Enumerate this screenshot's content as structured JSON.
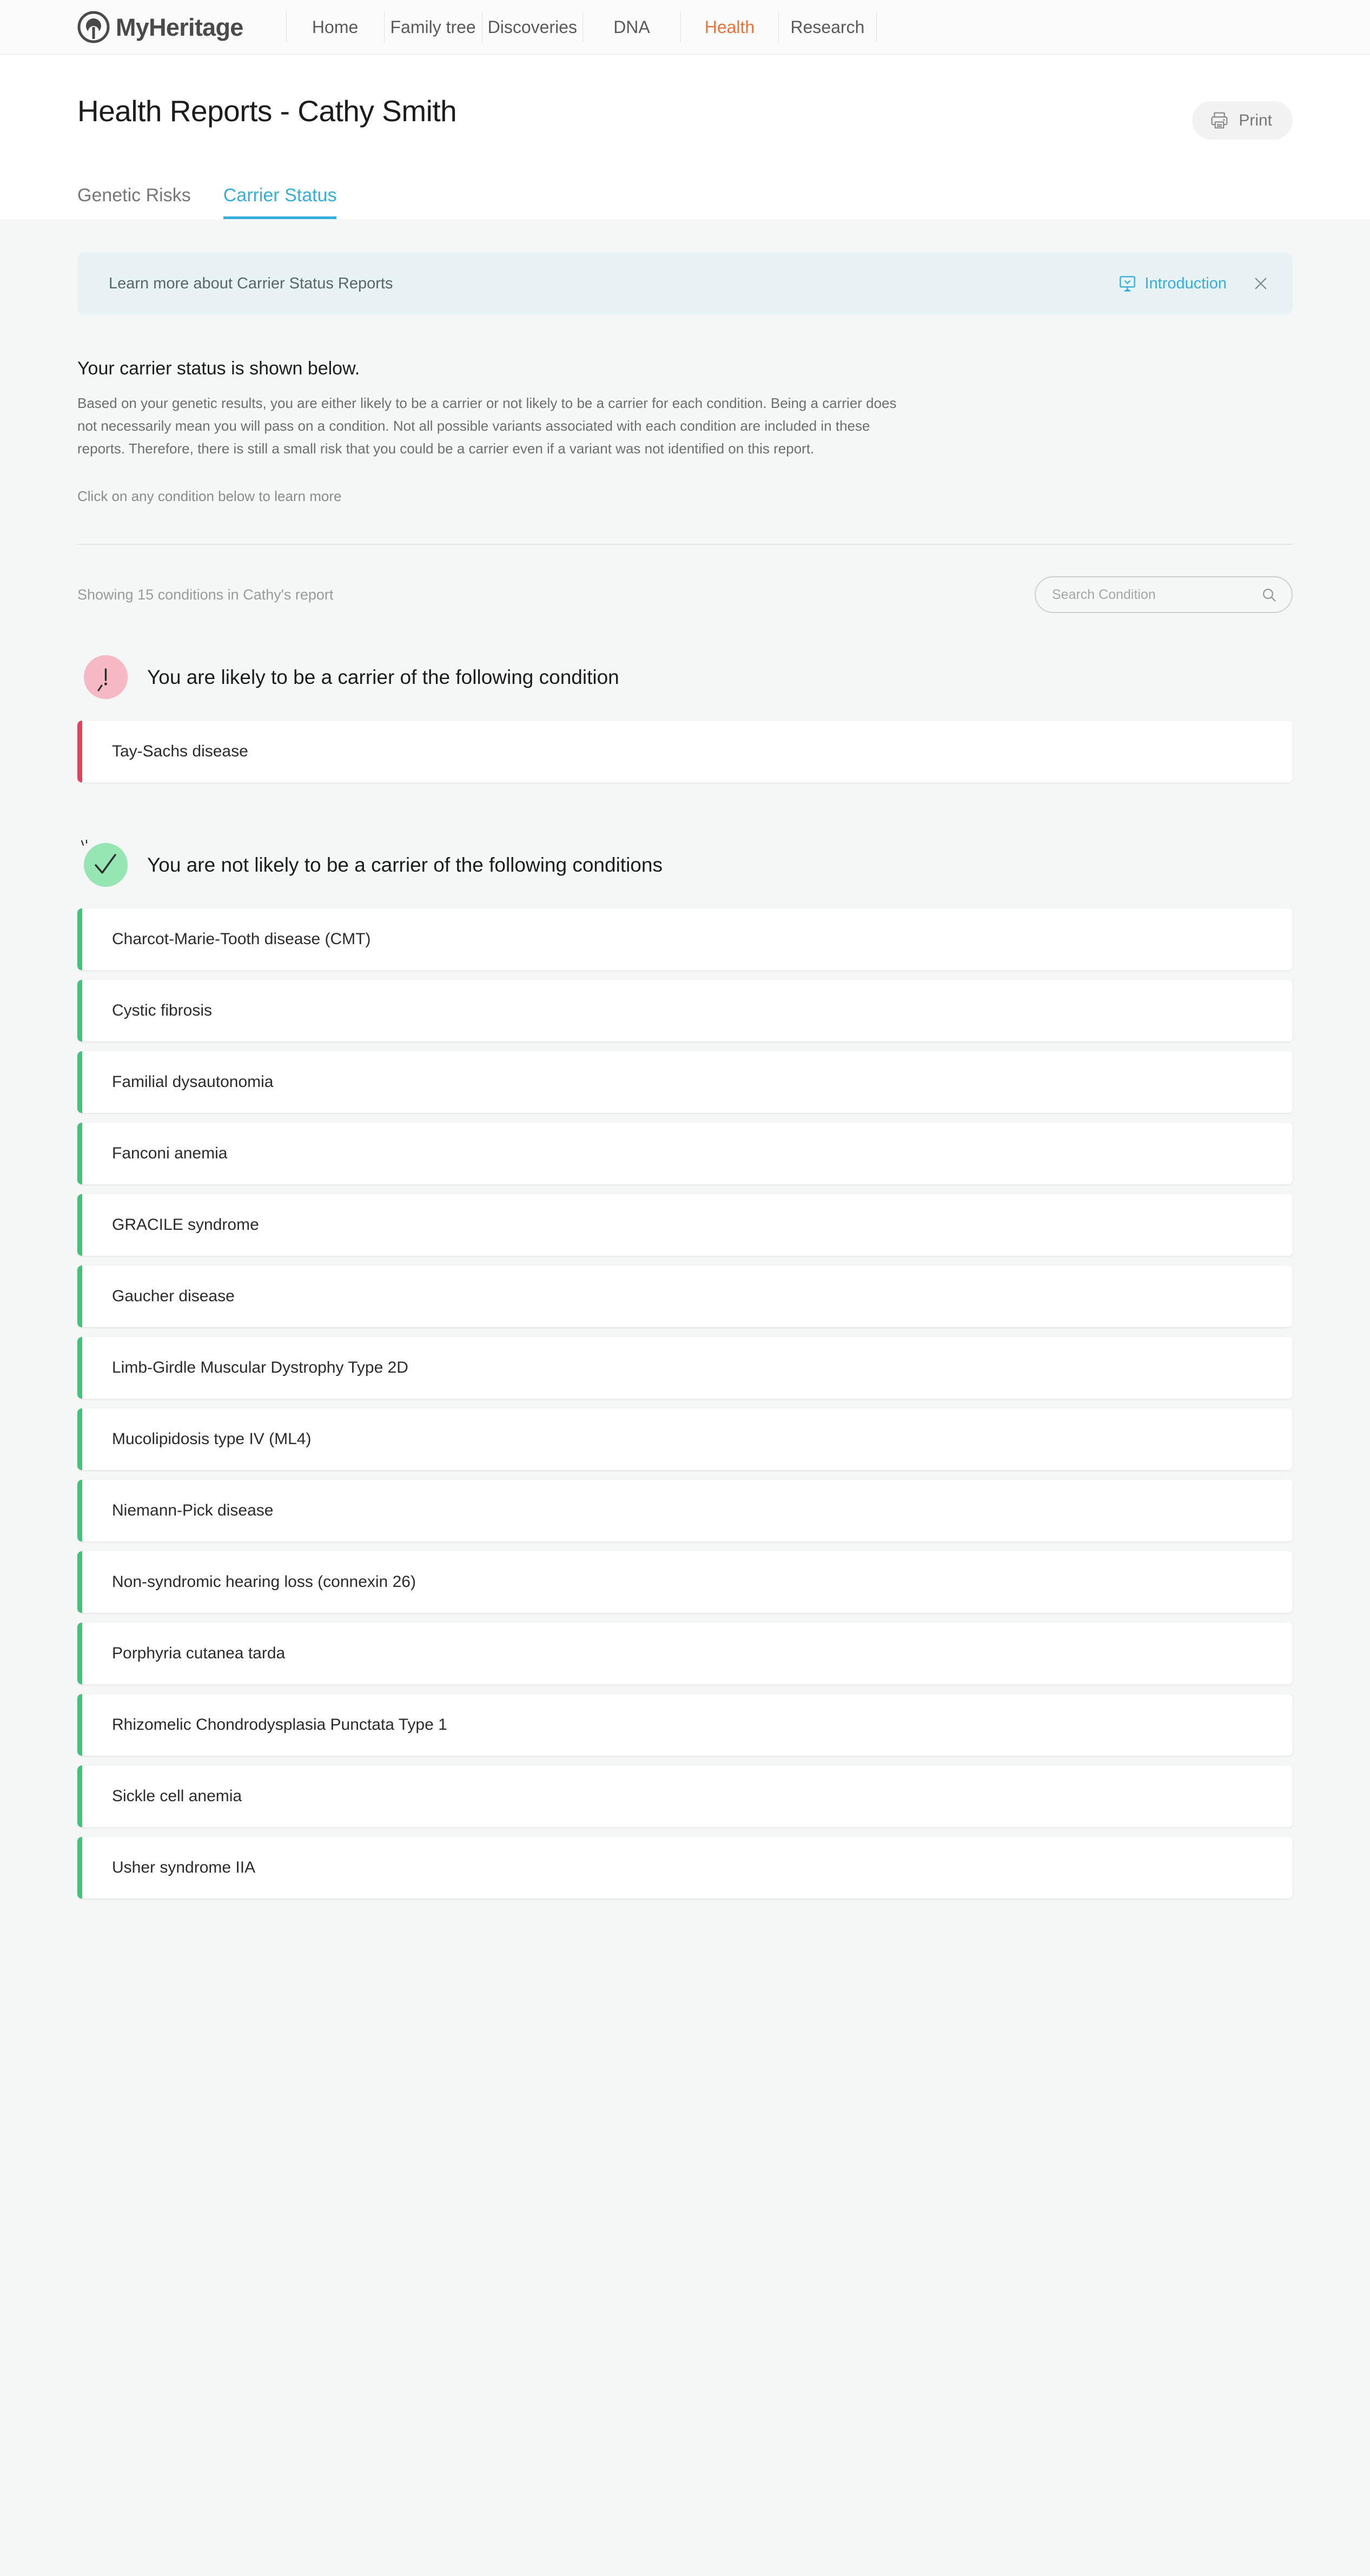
{
  "brand": {
    "name": "MyHeritage",
    "logo_icon": "myheritage-tree-logo"
  },
  "nav": {
    "items": [
      {
        "label": "Home",
        "active": false
      },
      {
        "label": "Family tree",
        "active": false
      },
      {
        "label": "Discoveries",
        "active": false
      },
      {
        "label": "DNA",
        "active": false
      },
      {
        "label": "Health",
        "active": true
      },
      {
        "label": "Research",
        "active": false
      }
    ],
    "active_color": "#e8743b"
  },
  "header": {
    "title": "Health Reports - Cathy Smith",
    "print_label": "Print",
    "print_icon": "printer-icon"
  },
  "tabs": [
    {
      "label": "Genetic Risks",
      "active": false
    },
    {
      "label": "Carrier Status",
      "active": true
    }
  ],
  "tab_accent_color": "#35aedb",
  "banner": {
    "text": "Learn more about Carrier Status Reports",
    "link_label": "Introduction",
    "link_icon": "presentation-board-icon",
    "close_icon": "close-icon",
    "background_color": "#e8f2f5"
  },
  "intro": {
    "lead": "Your carrier status is shown below.",
    "paragraph": "Based on your genetic results, you are either likely to be a carrier or not likely to be a carrier for each condition. Being a carrier does not necessarily mean you will pass on a condition. Not all possible variants associated with each condition are included in these reports. Therefore, there is still a small risk that you could be a carrier even if a variant was not identified on this report.",
    "click_hint": "Click on any condition below to learn more"
  },
  "list_bar": {
    "showing": "Showing 15 conditions in Cathy's report",
    "search_placeholder": "Search Condition",
    "search_value": "",
    "search_icon": "search-icon"
  },
  "sections": [
    {
      "id": "carrier",
      "title": "You are likely to be a carrier of the following condition",
      "badge_icon": "exclamation-icon",
      "badge_color": "#f6b8c2",
      "accent_color": "#ea3e5e",
      "conditions": [
        "Tay-Sachs disease"
      ]
    },
    {
      "id": "noncarrier",
      "title": "You are not likely to be a carrier of the following conditions",
      "badge_icon": "checkmark-icon",
      "badge_color": "#96e6b3",
      "accent_color": "#3fc47c",
      "conditions": [
        "Charcot-Marie-Tooth disease (CMT)",
        "Cystic fibrosis",
        "Familial dysautonomia",
        "Fanconi anemia",
        "GRACILE syndrome",
        "Gaucher disease",
        "Limb-Girdle Muscular Dystrophy Type 2D",
        "Mucolipidosis type IV (ML4)",
        "Niemann-Pick disease",
        "Non-syndromic hearing loss (connexin 26)",
        "Porphyria cutanea tarda",
        "Rhizomelic Chondrodysplasia Punctata Type 1",
        "Sickle cell anemia",
        "Usher syndrome IIA"
      ]
    }
  ]
}
